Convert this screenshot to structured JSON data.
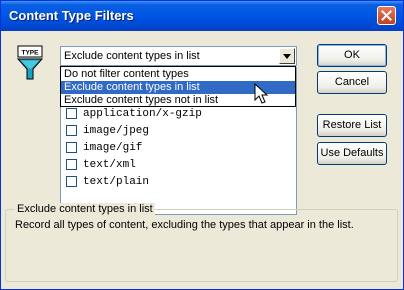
{
  "window": {
    "title": "Content Type Filters"
  },
  "filter_mode": {
    "selected": "Exclude content types in list",
    "options": [
      "Do not filter content types",
      "Exclude content types in list",
      "Exclude content types not in list"
    ]
  },
  "content_types": [
    {
      "label": "application/x-gzip",
      "checked": false
    },
    {
      "label": "image/jpeg",
      "checked": false
    },
    {
      "label": "image/gif",
      "checked": false
    },
    {
      "label": "text/xml",
      "checked": false
    },
    {
      "label": "text/plain",
      "checked": false
    }
  ],
  "buttons": {
    "ok": "OK",
    "cancel": "Cancel",
    "restore_list": "Restore List",
    "use_defaults": "Use Defaults"
  },
  "description": {
    "group_label": "Exclude content types in list",
    "text": "Record all types of content, excluding the types that appear in the list."
  },
  "icon_text": "TYPE",
  "icons": {
    "filter": "funnel-filter-icon",
    "close": "close-icon",
    "dropdown": "chevron-down-icon",
    "cursor": "mouse-pointer-icon"
  },
  "colors": {
    "titlebar": "#0055e5",
    "selection": "#316ac5",
    "close_button": "#d04a2b",
    "dialog_bg": "#ece9d8"
  }
}
